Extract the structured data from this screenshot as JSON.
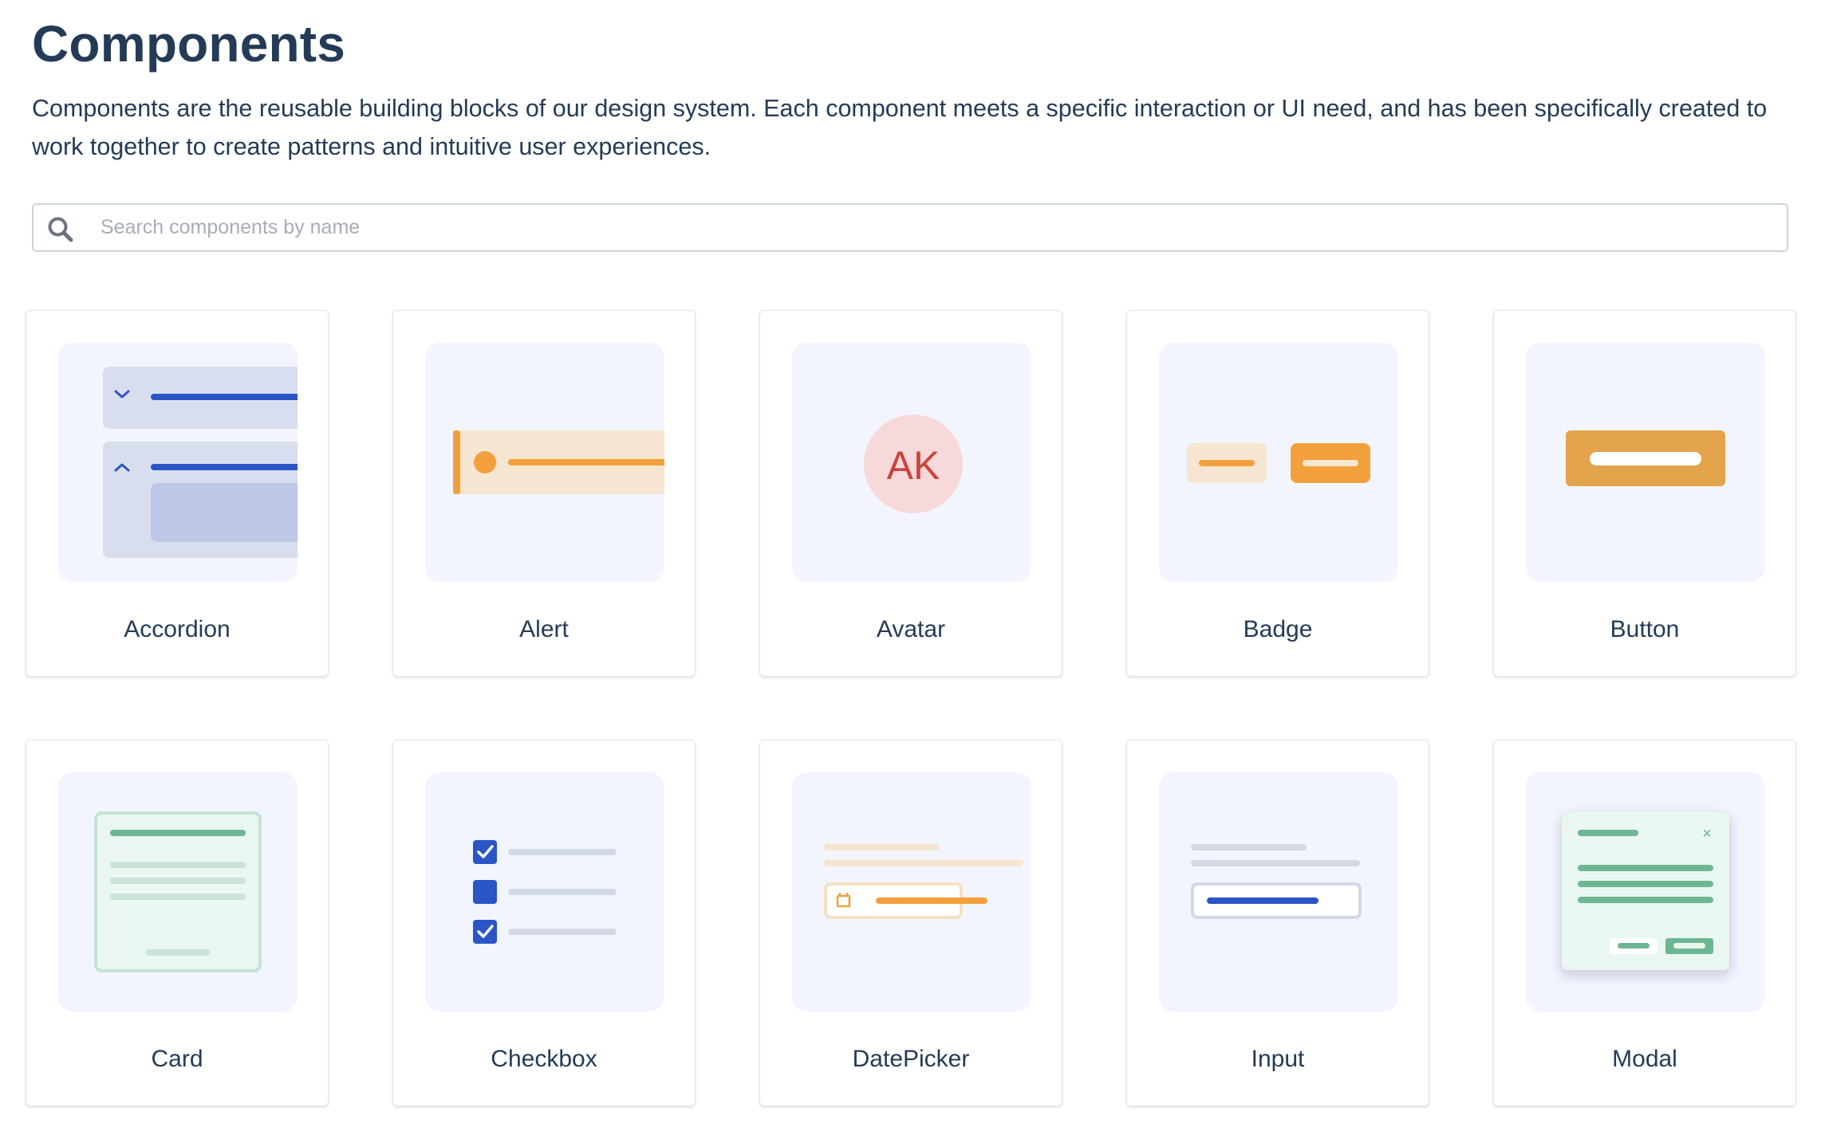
{
  "header": {
    "title": "Components",
    "description": "Components are the reusable building blocks of our design system. Each component meets a specific interaction or UI need, and has been specifically created to work together to create patterns and intuitive user experiences."
  },
  "search": {
    "placeholder": "Search components by name",
    "value": "",
    "icon": "search-icon"
  },
  "components": [
    {
      "label": "Accordion"
    },
    {
      "label": "Alert"
    },
    {
      "label": "Avatar",
      "initials": "AK"
    },
    {
      "label": "Badge"
    },
    {
      "label": "Button"
    },
    {
      "label": "Card"
    },
    {
      "label": "Checkbox"
    },
    {
      "label": "DatePicker"
    },
    {
      "label": "Input"
    },
    {
      "label": "Modal",
      "close_glyph": "×"
    }
  ],
  "colors": {
    "heading": "#243b57",
    "thumb_bg": "#f2f5fd",
    "blue": "#2b55c6",
    "orange": "#f2a03d",
    "green": "#6db694"
  }
}
